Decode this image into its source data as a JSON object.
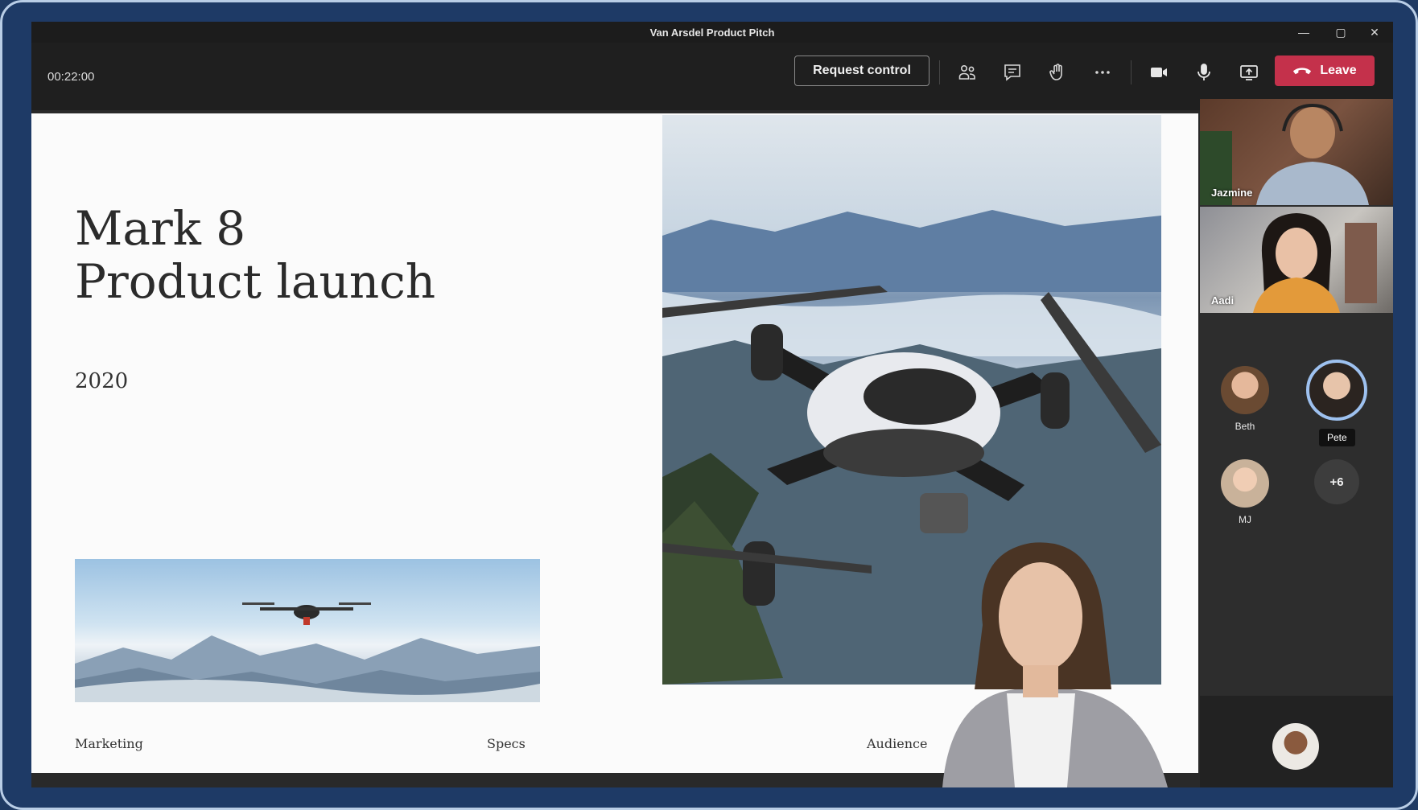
{
  "window": {
    "title": "Van Arsdel Product Pitch"
  },
  "toolbar": {
    "timer": "00:22:00",
    "request_control_label": "Request control",
    "leave_label": "Leave",
    "icons": [
      "people-icon",
      "chat-icon",
      "raise-hand-icon",
      "more-options-icon",
      "camera-icon",
      "microphone-icon",
      "share-screen-icon",
      "phone-hangup-icon"
    ]
  },
  "slide": {
    "title_line1": "Mark 8",
    "title_line2": "Product launch",
    "year": "2020",
    "footer": {
      "left": "Marketing",
      "middle": "Specs",
      "right": "Audience"
    }
  },
  "participants": {
    "video_tiles": [
      {
        "name": "Jazmine"
      },
      {
        "name": "Aadi"
      }
    ],
    "avatars": [
      {
        "name": "Beth"
      },
      {
        "name": "Pete",
        "speaking": true
      },
      {
        "name": "MJ"
      }
    ],
    "overflow_count": "+6"
  },
  "colors": {
    "leave": "#c4314b",
    "toolbar": "#1f1f1f",
    "frame": "#1e3a66",
    "speaking_ring": "#9ec1ef"
  }
}
